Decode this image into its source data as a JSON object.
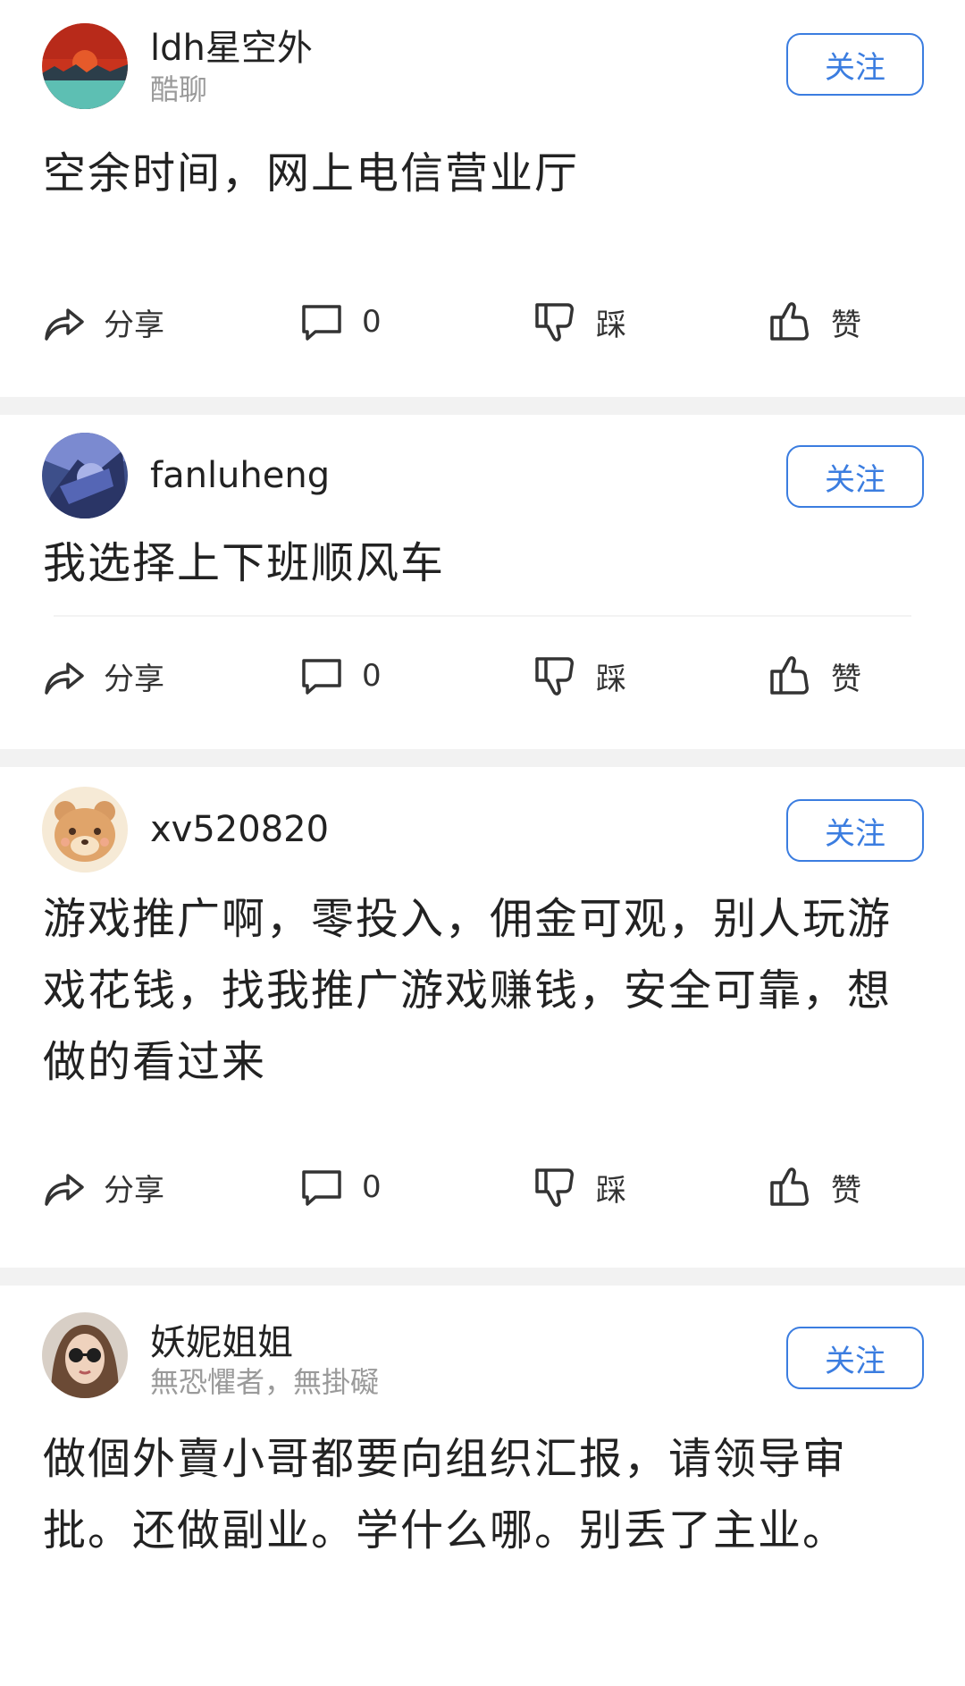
{
  "posts": [
    {
      "username": "ldh星空外",
      "subtitle": "酷聊",
      "follow_label": "关注",
      "content": "空余时间，网上电信营业厅",
      "share_label": "分享",
      "comment_count": "0",
      "dislike_label": "踩",
      "like_label": "赞"
    },
    {
      "username": "fanluheng",
      "follow_label": "关注",
      "content": "我选择上下班顺风车",
      "share_label": "分享",
      "comment_count": "0",
      "dislike_label": "踩",
      "like_label": "赞"
    },
    {
      "username": "xv520820",
      "follow_label": "关注",
      "content": "游戏推广啊，零投入，佣金可观，别人玩游戏花钱，找我推广游戏赚钱，安全可靠，想做的看过来",
      "share_label": "分享",
      "comment_count": "0",
      "dislike_label": "踩",
      "like_label": "赞"
    },
    {
      "username": "妖妮姐姐",
      "subtitle": "無恐懼者，無掛礙",
      "follow_label": "关注",
      "content": "做個外賣小哥都要向组织汇报，请领导审批。还做副业。学什么哪。别丢了主业。"
    }
  ],
  "colors": {
    "accent": "#3b7de0",
    "separator": "#f2f2f2"
  },
  "icons": [
    "share-icon",
    "comment-icon",
    "thumbs-down-icon",
    "thumbs-up-icon"
  ]
}
